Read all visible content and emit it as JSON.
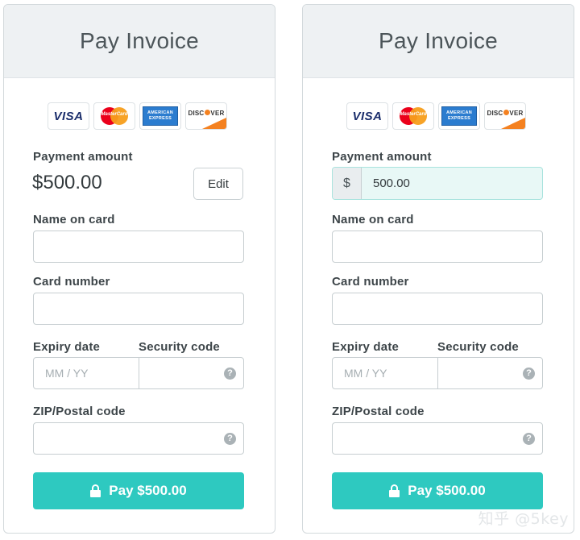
{
  "left_panel": {
    "title": "Pay Invoice",
    "payment_amount_label": "Payment amount",
    "payment_amount_value": "$500.00",
    "edit_label": "Edit",
    "name_label": "Name on card",
    "card_number_label": "Card number",
    "expiry_label": "Expiry date",
    "expiry_placeholder": "MM / YY",
    "security_label": "Security code",
    "zip_label": "ZIP/Postal code",
    "pay_label": "Pay $500.00"
  },
  "right_panel": {
    "title": "Pay Invoice",
    "payment_amount_label": "Payment amount",
    "currency_symbol": "$",
    "payment_amount_input": "500.00",
    "name_label": "Name on card",
    "card_number_label": "Card number",
    "expiry_label": "Expiry date",
    "expiry_placeholder": "MM / YY",
    "security_label": "Security code",
    "zip_label": "ZIP/Postal code",
    "pay_label": "Pay $500.00"
  },
  "card_logos": {
    "visa": "VISA",
    "mastercard": "MasterCard",
    "amex_line1": "AMERICAN",
    "amex_line2": "EXPRESS",
    "discover_pre": "DISC",
    "discover_post": "VER"
  },
  "icons": {
    "help": "?",
    "lock": "lock-icon"
  },
  "colors": {
    "accent": "#2ec9c0",
    "header_bg": "#eef1f3",
    "amount_input_bg": "#e8f8f6"
  },
  "watermark": "知乎 @5key"
}
